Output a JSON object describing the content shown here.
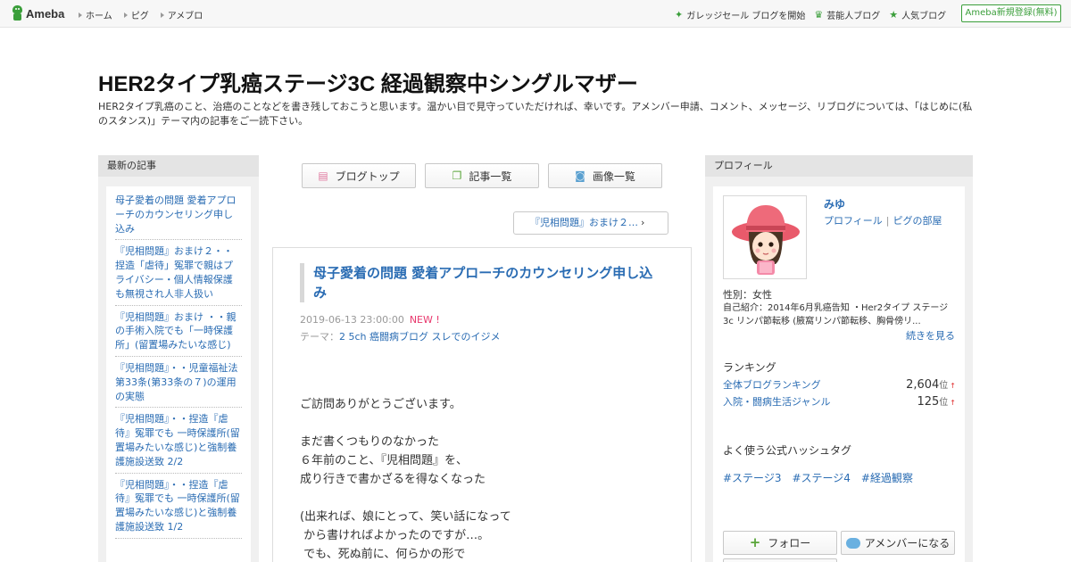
{
  "topbar": {
    "logo": "Ameba",
    "nav": [
      "ホーム",
      "ピグ",
      "アメブロ"
    ],
    "links": [
      {
        "icon": "sparkle-icon",
        "label": "ガレッジセール ブログを開始"
      },
      {
        "icon": "crown-icon",
        "label": "芸能人ブログ"
      },
      {
        "icon": "star-icon",
        "label": "人気ブログ"
      }
    ],
    "signup": "Ameba新規登録(無料)",
    "accent": "#3a9e3a"
  },
  "header": {
    "title": "HER2タイプ乳癌ステージ3C 経過観察中シングルマザー",
    "description": "HER2タイプ乳癌のこと、治癌のことなどを書き残しておこうと思います。温かい目で見守っていただければ、幸いです。アメンバー申請、コメント、メッセージ、リブログについては、「はじめに(私のスタンス)」テーマ内の記事をご一読下さい。"
  },
  "recent": {
    "heading": "最新の記事",
    "items": [
      "母子愛着の問題 愛着アプローチのカウンセリング申し込み",
      "『児相問題』おまけ２・・捏造「虐待」冤罪で親はプライバシー・個人情報保護も無視され人非人扱い",
      "『児相問題』おまけ ・・親の手術入院でも「一時保護所」(留置場みたいな感じ)",
      "『児相問題』・・児童福祉法第33条(第33条の７)の運用の実態",
      "『児相問題』・・捏造『虐待』冤罪でも 一時保護所(留置場みたいな感じ)と強制養護施設送致 2/2",
      "『児相問題』・・捏造『虐待』冤罪でも 一時保護所(留置場みたいな感じ)と強制養護施設送致 1/2"
    ]
  },
  "toolbar": {
    "blog_top": "ブログトップ",
    "articles": "記事一覧",
    "images": "画像一覧"
  },
  "next_post": "『児相問題』おまけ２…",
  "article": {
    "title": "母子愛着の問題 愛着アプローチのカウンセリング申し込み",
    "date": "2019-06-13 23:00:00",
    "new_badge": "NEW !",
    "theme_label": "テーマ：",
    "theme": "2 5ch 癌闘病ブログ スレでのイジメ",
    "body": "ご訪問ありがとうございます。\n\nまだ書くつもりのなかった\n６年前のこと、『児相問題』を、\n成り行きで書かざるを得なくなった\n\n(出来れば、娘にとって、笑い話になって\n から書ければよかったのですが…。\n でも、死ぬ前に、何らかの形で"
  },
  "profile": {
    "heading": "プロフィール",
    "name": "みゆ",
    "link_profile": "プロフィール",
    "link_pigg": "ピグの部屋",
    "gender": "性別：女性",
    "intro": "自己紹介：2014年6月乳癌告知 ・Her2タイプ ステージ3c リンパ節転移 (腋窩リンパ節転移、胸骨傍リ...",
    "more": "続きを見る",
    "ranking_heading": "ランキング",
    "rankings": [
      {
        "label": "全体ブログランキング",
        "value": "2,604",
        "unit": "位",
        "trend": "↑"
      },
      {
        "label": "入院・闘病生活ジャンル",
        "value": "125",
        "unit": "位",
        "trend": "↑"
      }
    ],
    "hashtag_heading": "よく使う公式ハッシュタグ",
    "hashtags": [
      "#ステージ3",
      "#ステージ4",
      "#経過観察"
    ],
    "follow": "フォロー",
    "amember": "アメンバーになる"
  }
}
